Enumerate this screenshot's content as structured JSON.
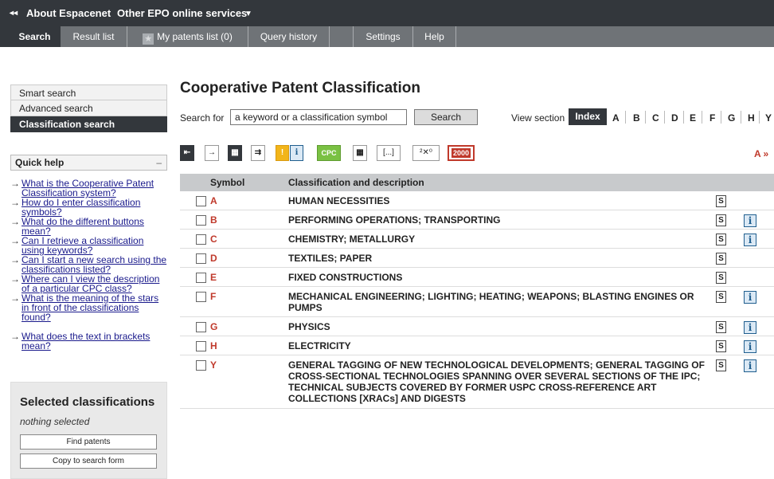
{
  "topbar": {
    "back_arrow": "◂◂",
    "about": "About Espacenet",
    "other": "Other EPO online services",
    "dropdown_arrow": "▼"
  },
  "tabs": [
    {
      "label": "Search"
    },
    {
      "label": "Result list"
    },
    {
      "label": "My patents list (0)"
    },
    {
      "label": "Query history"
    },
    {
      "label": ""
    },
    {
      "label": "Settings"
    },
    {
      "label": "Help"
    }
  ],
  "sidebar": {
    "nav": [
      "Smart search",
      "Advanced search",
      "Classification search"
    ],
    "quick_help_title": "Quick help",
    "quick_help_collapse": "–",
    "quick_help": [
      "What is the Cooperative Patent Classification system?",
      "How do I enter classification symbols?",
      "What do the different buttons mean?",
      "Can I retrieve a classification using keywords?",
      "Can I start a new search using the classifications listed?",
      "Where can I view the description of a particular CPC class?",
      "What is the meaning of the stars in front of the classifications found?",
      "What does the text in brackets mean?"
    ],
    "selected": {
      "title": "Selected classifications",
      "empty": "nothing selected",
      "find_btn": "Find patents",
      "copy_btn": "Copy to search form"
    }
  },
  "main": {
    "title": "Cooperative Patent Classification",
    "search_label": "Search for",
    "search_value": "a keyword or a classification symbol",
    "search_btn": "Search",
    "view_section_label": "View section",
    "index_label": "Index",
    "letters": [
      "A",
      "B",
      "C",
      "D",
      "E",
      "F",
      "G",
      "H",
      "Y"
    ],
    "toolbar": [
      "⇤",
      "→",
      "▦",
      "⇉",
      "!",
      "i",
      "CPC",
      "▦",
      "[...]",
      "²✕⁰",
      "2000"
    ],
    "a_nav": "A »",
    "columns": {
      "symbol": "Symbol",
      "desc": "Classification and description"
    },
    "rows": [
      {
        "sym": "A",
        "desc": "HUMAN NECESSITIES",
        "info": false
      },
      {
        "sym": "B",
        "desc": "PERFORMING OPERATIONS; TRANSPORTING",
        "info": true
      },
      {
        "sym": "C",
        "desc": "CHEMISTRY; METALLURGY",
        "info": true
      },
      {
        "sym": "D",
        "desc": "TEXTILES; PAPER",
        "info": false
      },
      {
        "sym": "E",
        "desc": "FIXED CONSTRUCTIONS",
        "info": false
      },
      {
        "sym": "F",
        "desc": "MECHANICAL ENGINEERING; LIGHTING; HEATING; WEAPONS; BLASTING ENGINES OR PUMPS",
        "info": true
      },
      {
        "sym": "G",
        "desc": "PHYSICS",
        "info": true
      },
      {
        "sym": "H",
        "desc": "ELECTRICITY",
        "info": true
      },
      {
        "sym": "Y",
        "desc": "GENERAL TAGGING OF NEW TECHNOLOGICAL DEVELOPMENTS; GENERAL TAGGING OF CROSS-SECTIONAL TECHNOLOGIES SPANNING OVER SEVERAL SECTIONS OF THE IPC; TECHNICAL SUBJECTS COVERED BY FORMER USPC CROSS-REFERENCE ART COLLECTIONS [XRACs] AND DIGESTS",
        "info": true
      }
    ],
    "s_icon": "S",
    "i_icon": "i"
  }
}
